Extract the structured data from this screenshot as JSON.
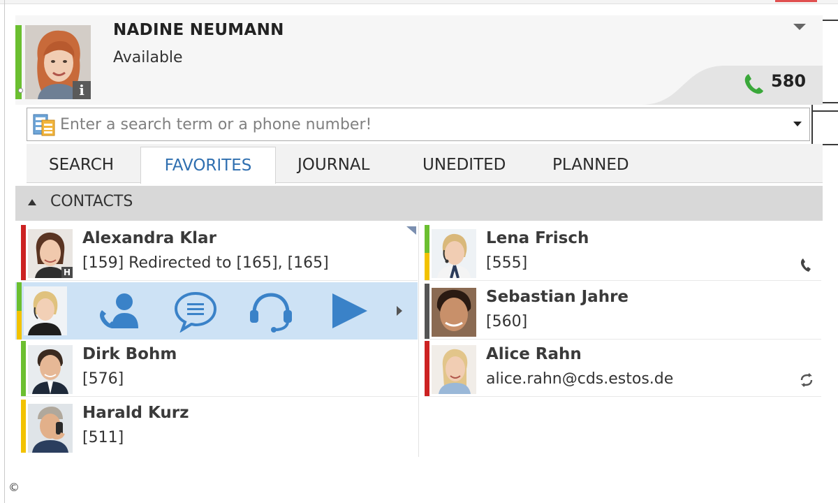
{
  "user": {
    "name": "NADINE NEUMANN",
    "status": "Available",
    "line_number": "580",
    "info_badge": "i",
    "status_color": "#6bbf30"
  },
  "search": {
    "value": "",
    "placeholder": "Enter a search term or a phone number!"
  },
  "tabs": [
    {
      "label": "SEARCH",
      "active": false
    },
    {
      "label": "FAVORITES",
      "active": true
    },
    {
      "label": "JOURNAL",
      "active": false
    },
    {
      "label": "UNEDITED",
      "active": false
    },
    {
      "label": "PLANNED",
      "active": false
    }
  ],
  "section": {
    "title": "CONTACTS"
  },
  "contacts": [
    {
      "name": "Alexandra Klar",
      "detail": "[159] Redirected to  [165], [165]",
      "status_top": "#cc2222",
      "status_bottom": "#cc2222",
      "icon": "info-badge"
    },
    {
      "name": "Lena Frisch",
      "detail": "[555]",
      "status_top": "#6bbf30",
      "status_bottom": "#f2c200",
      "icon": "phone-icon"
    },
    {
      "name": "",
      "detail": "",
      "status_top": "#6bbf30",
      "status_bottom": "#f2c200",
      "icon": "",
      "hovered": true
    },
    {
      "name": "Sebastian Jahre",
      "detail": "[560]",
      "status_top": "#555555",
      "status_bottom": "#555555",
      "icon": ""
    },
    {
      "name": "Dirk Bohm",
      "detail": "[576]",
      "status_top": "#6bbf30",
      "status_bottom": "#6bbf30",
      "icon": ""
    },
    {
      "name": "Alice Rahn",
      "detail": "alice.rahn@cds.estos.de",
      "status_top": "#cc2222",
      "status_bottom": "#cc2222",
      "icon": "redirect-icon"
    },
    {
      "name": "Harald Kurz",
      "detail": "[511]",
      "status_top": "#f2c200",
      "status_bottom": "#f2c200",
      "icon": ""
    }
  ],
  "hover_actions": [
    "call-contact-icon",
    "chat-icon",
    "headset-icon",
    "play-icon",
    "more-arrow-icon"
  ],
  "colors": {
    "accent": "#2f6fb0",
    "action_blue": "#3a82c8",
    "hover_bg": "#cde2f5",
    "line_green": "#3aa83a"
  },
  "copyright": "©"
}
